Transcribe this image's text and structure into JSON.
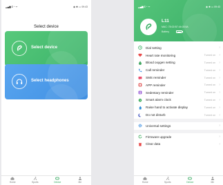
{
  "left_screen": {
    "status": {
      "left": "▂▄▆ 𝗜 ⁺ ᯤ",
      "right": "◉ ✱ ▭ 09:43"
    },
    "title": "Select device",
    "cards": [
      {
        "label": "Select device",
        "icon": "band-icon",
        "color": "#4cc073"
      },
      {
        "label": "Select headphones",
        "icon": "headphones-icon",
        "color": "#4b99e8"
      }
    ]
  },
  "right_screen": {
    "status": {
      "left": "▂▄▆ 𝗜 ⁺ ᯤ",
      "right": "◉ ✱ ▭ 09:43"
    },
    "device": {
      "name": "L11",
      "mac": "MAC: 78:02:B7:44:03:5A",
      "battery_label": "Battery"
    },
    "menu_group_1": [
      {
        "label": "Dial setting",
        "value": "",
        "icon": "dial-icon",
        "color": "#43b36a"
      },
      {
        "label": "Heart rate monitoring",
        "value": "Turned on",
        "icon": "heart-icon",
        "color": "#e84a4a"
      },
      {
        "label": "Blood oxygen setting",
        "value": "Turned on",
        "icon": "drop-icon",
        "color": "#46a865"
      },
      {
        "label": "Call reminder",
        "value": "Turned on",
        "icon": "phone-icon",
        "color": "#3a8de0"
      },
      {
        "label": "SMS reminder",
        "value": "Turned on",
        "icon": "sms-icon",
        "color": "#e94f6e"
      },
      {
        "label": "APP reminder",
        "value": "Turned on",
        "icon": "app-icon",
        "color": "#e05555"
      },
      {
        "label": "Sedentary reminder",
        "value": "Turned on",
        "icon": "sedentary-icon",
        "color": "#9a5ed6"
      },
      {
        "label": "Smart alarm clock",
        "value": "Turned on",
        "icon": "alarm-icon",
        "color": "#3fae5f"
      },
      {
        "label": "Raise hand to activate display",
        "value": "Turned on",
        "icon": "hand-icon",
        "color": "#2f8fd8"
      },
      {
        "label": "Do not disturb",
        "value": "Turned on",
        "icon": "moon-icon",
        "color": "#3a4dbd"
      }
    ],
    "menu_group_2": [
      {
        "label": "Universal settings",
        "value": "",
        "icon": "gear-icon",
        "color": "#3a8de0"
      }
    ],
    "menu_group_3": [
      {
        "label": "Firmware upgrade",
        "value": "",
        "icon": "refresh-icon",
        "color": "#3fae5f"
      },
      {
        "label": "Clear data",
        "value": "",
        "icon": "trash-icon",
        "color": "#e84a4a"
      }
    ]
  },
  "tabbar": {
    "tabs": [
      {
        "label": "Home",
        "icon": "home-icon"
      },
      {
        "label": "Sports",
        "icon": "sports-icon"
      },
      {
        "label": "Device",
        "icon": "device-icon"
      },
      {
        "label": "Me",
        "icon": "person-icon"
      }
    ],
    "active_tab": "Device",
    "active_color": "#2fa65a"
  }
}
